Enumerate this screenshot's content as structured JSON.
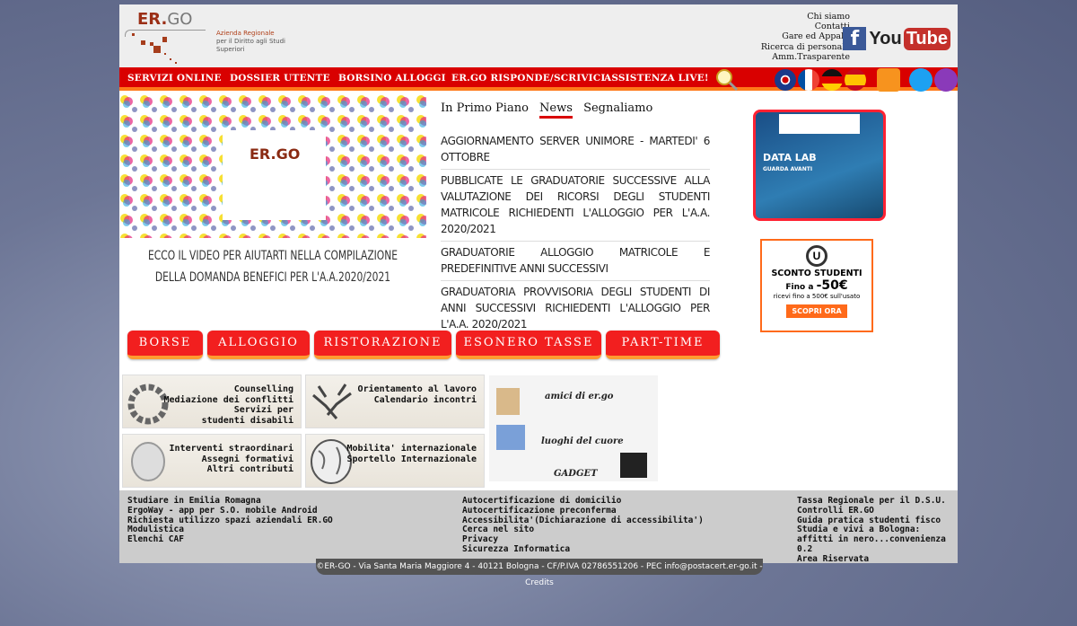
{
  "header": {
    "logo_text": "ER.GO",
    "logo_line1": "Azienda Regionale",
    "logo_line2": "per il Diritto agli Studi Superiori",
    "toplinks": [
      "Chi siamo",
      "Contatti",
      "Gare ed Appalti",
      "Ricerca di personale",
      "Amm.Trasparente"
    ],
    "youtube_you": "You",
    "youtube_tube": "Tube",
    "facebook": "f"
  },
  "nav": {
    "items": [
      "SERVIZI ONLINE",
      "DOSSIER UTENTE",
      "BORSINO ALLOGGI",
      "ER.GO RISPONDE/SCRIVICI",
      "ASSISTENZA LIVE!"
    ],
    "languages": [
      "english",
      "francais",
      "deutsch",
      "espanol"
    ],
    "icons": [
      "search-icon",
      "rss-icon",
      "twitter-icon",
      "instagram-icon"
    ]
  },
  "video": {
    "logo": "ER.GO",
    "caption_line1": "ECCO IL VIDEO PER AIUTARTI NELLA COMPILAZIONE",
    "caption_line2": "DELLA DOMANDA BENEFICI PER L'A.A.2020/2021"
  },
  "tabs": [
    {
      "label": "In Primo Piano"
    },
    {
      "label": "News",
      "active": true
    },
    {
      "label": "Segnaliamo"
    }
  ],
  "news": [
    "AGGIORNAMENTO SERVER UNIMORE - MARTEDI' 6 OTTOBRE",
    "PUBBLICATE LE GRADUATORIE SUCCESSIVE ALLA VALUTAZIONE DEI RICORSI DEGLI STUDENTI MATRICOLE RICHIEDENTI L'ALLOGGIO PER L'A.A. 2020/2021",
    "GRADUATORIE ALLOGGIO MATRICOLE E PREDEFINITIVE ANNI SUCCESSIVI",
    "GRADUATORIA PROVVISORIA DEGLI STUDENTI DI ANNI SUCCESSIVI RICHIEDENTI L'ALLOGGIO PER L'A.A. 2020/2021"
  ],
  "ads": {
    "datalab_title": "DATA LAB",
    "datalab_sub": "GUARDA AVANTI",
    "sconto_title": "SCONTO STUDENTI",
    "sconto_fino": "Fino a",
    "sconto_amount": "-50€",
    "sconto_desc": "ricevi fino a 500€ sull'usato",
    "sconto_button": "SCOPRI ORA"
  },
  "categories": [
    "BORSE",
    "ALLOGGIO",
    "RISTORAZIONE",
    "ESONERO TASSE",
    "PART-TIME"
  ],
  "tiles": [
    {
      "lines": [
        "Counselling",
        "Mediazione dei conflitti",
        "Servizi per",
        "studenti disabili"
      ]
    },
    {
      "lines": [
        "Orientamento al lavoro",
        "Calendario incontri"
      ]
    },
    {
      "lines": [
        "Interventi straordinari",
        "Assegni formativi",
        "Altri contributi"
      ]
    },
    {
      "lines": [
        "Mobilita' internazionale",
        "Sportello Internazionale"
      ]
    }
  ],
  "gadget": {
    "line1": "amici di er.go",
    "line2": "luoghi del cuore",
    "line3": "GADGET"
  },
  "footer": {
    "col1": [
      "Studiare in Emilia Romagna",
      "ErgoWay - app per S.O. mobile Android",
      "Richiesta utilizzo spazi aziendali ER.GO",
      "Modulistica",
      "Elenchi CAF"
    ],
    "col2": [
      "Autocertificazione di domicilio",
      "Autocertificazione preconferma",
      "Accessibilita'(Dichiarazione di accessibilita')",
      "Cerca nel sito",
      "Privacy",
      "Sicurezza Informatica"
    ],
    "col3": [
      "Tassa Regionale per il D.S.U.",
      "Controlli ER.GO",
      "Guida pratica studenti fisco",
      "Studia e vivi a Bologna: affitti in nero...convenienza 0.2",
      "Area Riservata"
    ],
    "copyright": "©ER-GO - Via Santa Maria Maggiore 4 - 40121 Bologna - CF/P.IVA 02786551206 - PEC info@postacert.er-go.it - Credits"
  },
  "colors": {
    "nav_red": "#d90000",
    "accent_orange": "#ff7a1a",
    "button_red": "#f21f1f",
    "footer_gray": "#cccccc"
  }
}
